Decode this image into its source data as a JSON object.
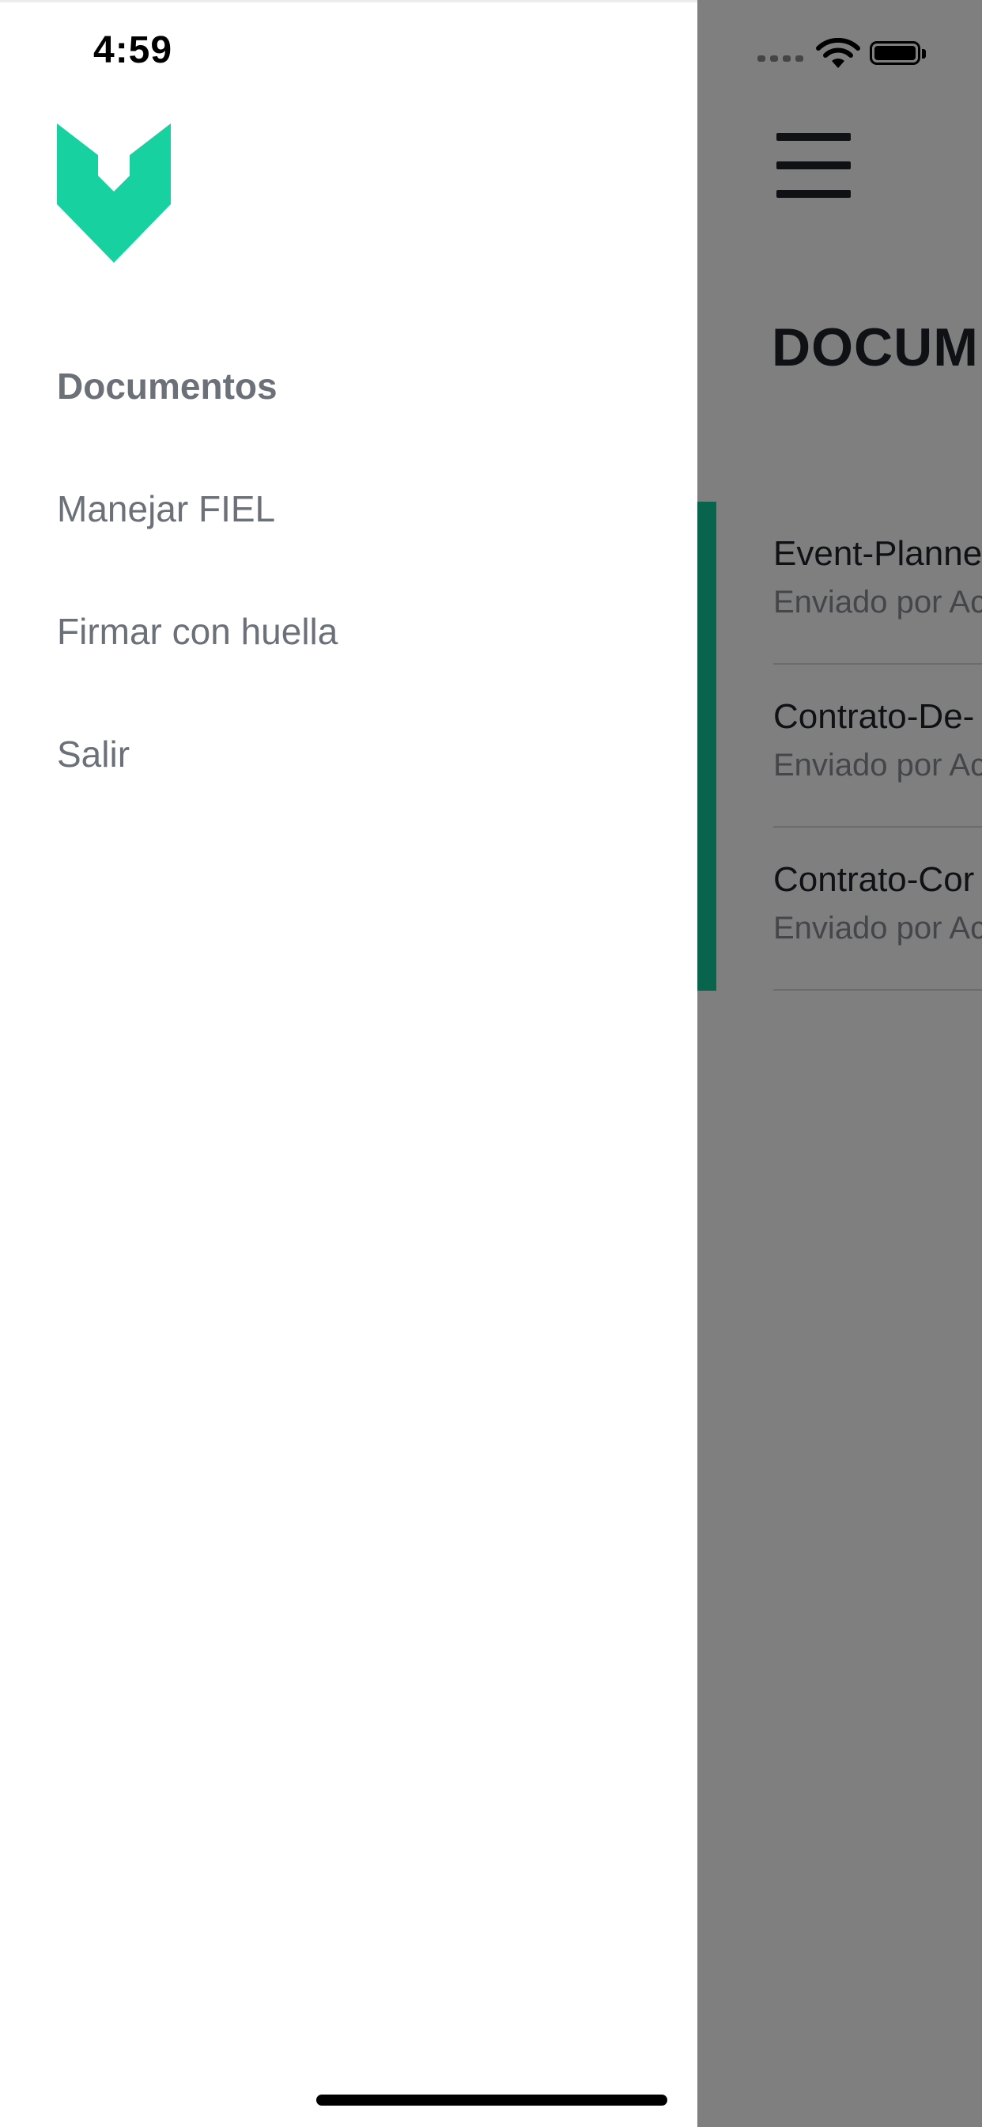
{
  "status_bar": {
    "time": "4:59"
  },
  "main": {
    "title": "DOCUM",
    "documents": [
      {
        "title": "Event-Planne",
        "subtitle": "Enviado por Ac"
      },
      {
        "title": "Contrato-De-",
        "subtitle": "Enviado por Ac"
      },
      {
        "title": "Contrato-Cor",
        "subtitle": "Enviado por Ac"
      }
    ]
  },
  "drawer": {
    "menu_items": [
      {
        "label": "Documentos"
      },
      {
        "label": "Manejar FIEL"
      },
      {
        "label": "Firmar con huella"
      },
      {
        "label": "Salir"
      }
    ]
  },
  "colors": {
    "brand_green": "#17d1a0",
    "accent_dark_green": "#12c99a",
    "overlay": "rgba(0,0,0,0.5)"
  },
  "icons": [
    "menu-icon",
    "signal-icon",
    "wifi-icon",
    "battery-icon",
    "brand-logo"
  ]
}
